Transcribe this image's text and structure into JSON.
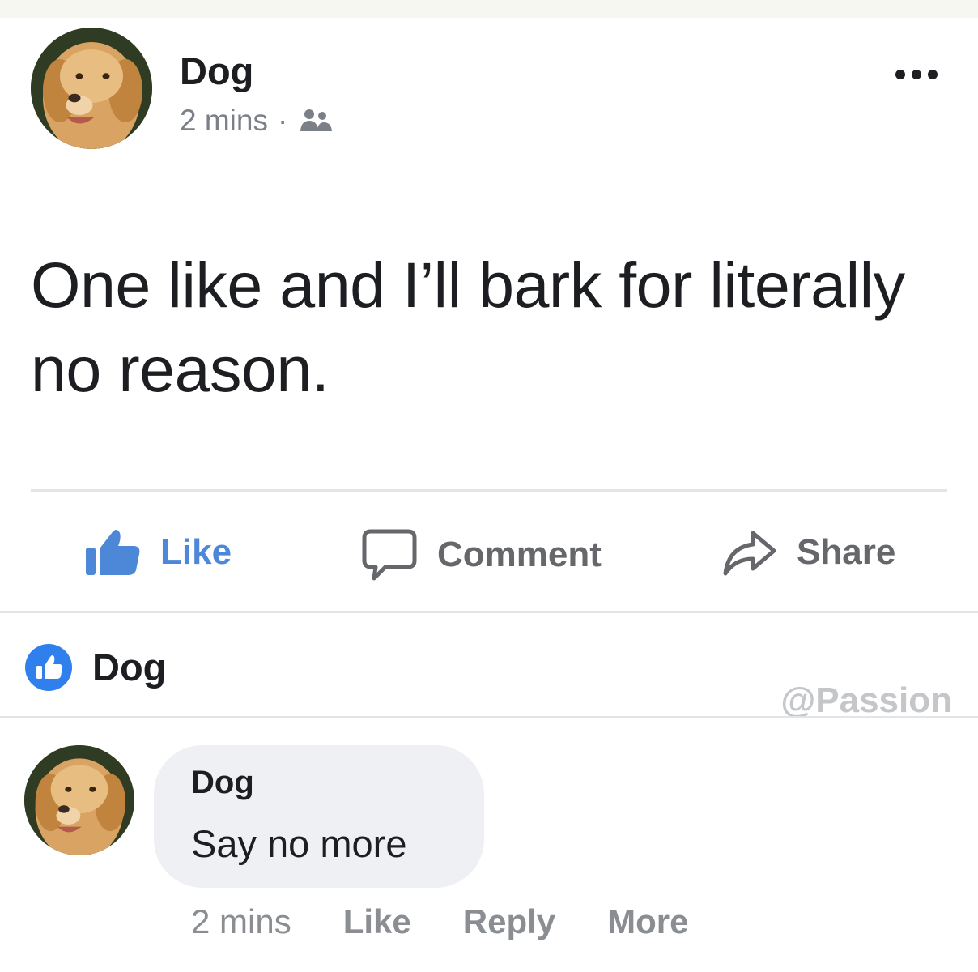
{
  "post": {
    "author": "Dog",
    "time": "2 mins",
    "separator": "·",
    "audience_icon": "friends-icon",
    "text": "One like and I’ll bark for literally no reason."
  },
  "actions": {
    "like_label": "Like",
    "comment_label": "Comment",
    "share_label": "Share"
  },
  "reactions": {
    "reactor": "Dog",
    "icon": "like-reaction-icon"
  },
  "watermark": "@Passion",
  "comment": {
    "author": "Dog",
    "text": "Say no more",
    "time": "2 mins",
    "like_label": "Like",
    "reply_label": "Reply",
    "more_label": "More"
  },
  "colors": {
    "like_blue": "#4d88d8",
    "muted_text": "#65676b",
    "bubble_bg": "#eef0f3",
    "reaction_badge": "#2f80ed"
  }
}
